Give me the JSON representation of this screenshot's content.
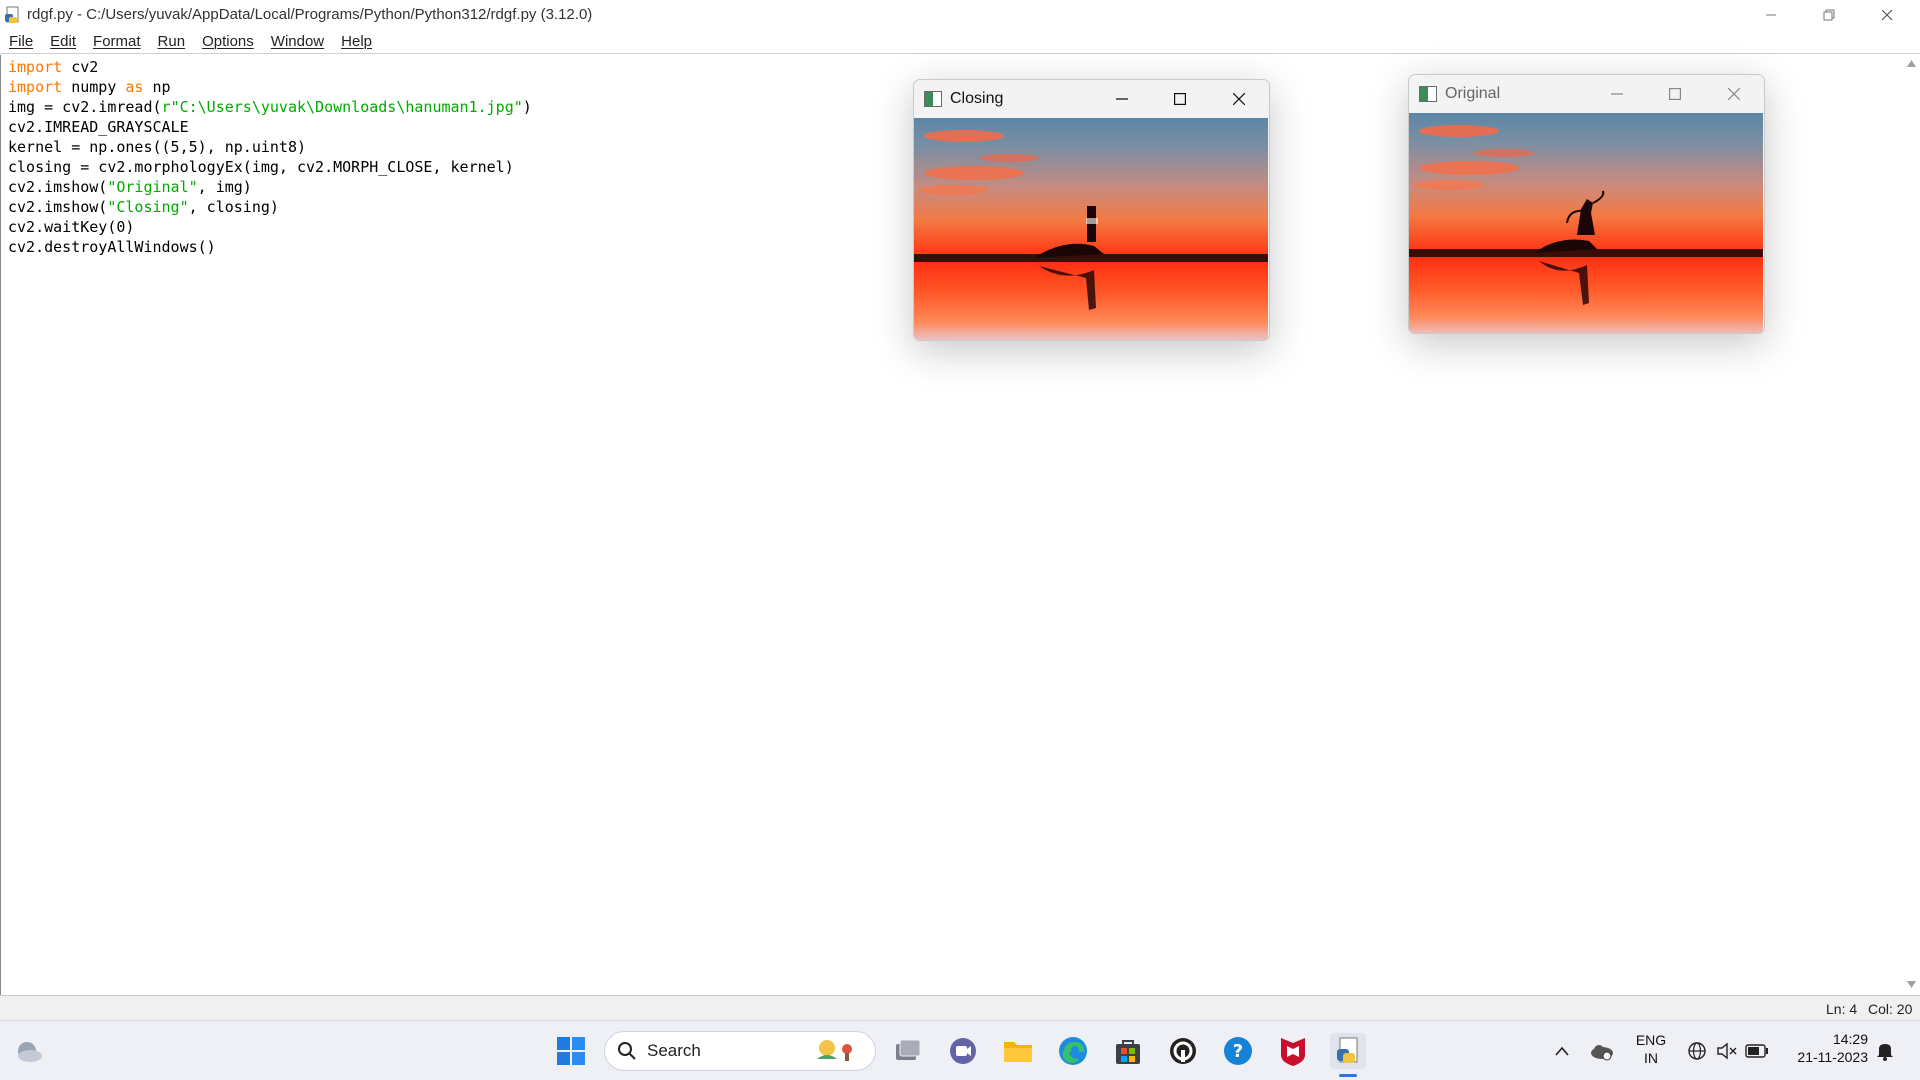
{
  "window": {
    "title": "rdgf.py - C:/Users/yuvak/AppData/Local/Programs/Python/Python312/rdgf.py (3.12.0)"
  },
  "menu": [
    "File",
    "Edit",
    "Format",
    "Run",
    "Options",
    "Window",
    "Help"
  ],
  "code_lines": [
    [
      {
        "t": "import",
        "c": "kw"
      },
      {
        "t": " cv2",
        "c": ""
      }
    ],
    [
      {
        "t": "import",
        "c": "kw"
      },
      {
        "t": " numpy ",
        "c": ""
      },
      {
        "t": "as",
        "c": "kw"
      },
      {
        "t": " np",
        "c": ""
      }
    ],
    [
      {
        "t": "img = cv2.imread(",
        "c": ""
      },
      {
        "t": "r\"C:\\Users\\yuvak\\Downloads\\hanuman1.jpg\"",
        "c": "str"
      },
      {
        "t": ")",
        "c": ""
      }
    ],
    [
      {
        "t": "cv2.IMREAD_GRAYSCALE",
        "c": ""
      }
    ],
    [
      {
        "t": "kernel = np.ones((5,5), np.uint8)",
        "c": ""
      }
    ],
    [
      {
        "t": "closing = cv2.morphologyEx(img, cv2.MORPH_CLOSE, kernel)",
        "c": ""
      }
    ],
    [
      {
        "t": "cv2.imshow(",
        "c": ""
      },
      {
        "t": "\"Original\"",
        "c": "str"
      },
      {
        "t": ", img)",
        "c": ""
      }
    ],
    [
      {
        "t": "cv2.imshow(",
        "c": ""
      },
      {
        "t": "\"Closing\"",
        "c": "str"
      },
      {
        "t": ", closing)",
        "c": ""
      }
    ],
    [
      {
        "t": "cv2.waitKey(0)",
        "c": ""
      }
    ],
    [
      {
        "t": "cv2.destroyAllWindows()",
        "c": ""
      }
    ]
  ],
  "status": {
    "line": "Ln: 4",
    "col": "Col: 20"
  },
  "closing_window": {
    "title": "Closing"
  },
  "original_window": {
    "title": "Original"
  },
  "taskbar": {
    "search_label": "Search",
    "language_top": "ENG",
    "language_bottom": "IN",
    "time": "14:29",
    "date": "21-11-2023"
  },
  "colors": {
    "keyword": "#ff7700",
    "string": "#00aa00",
    "taskbar_bg": "#eef0f5"
  }
}
